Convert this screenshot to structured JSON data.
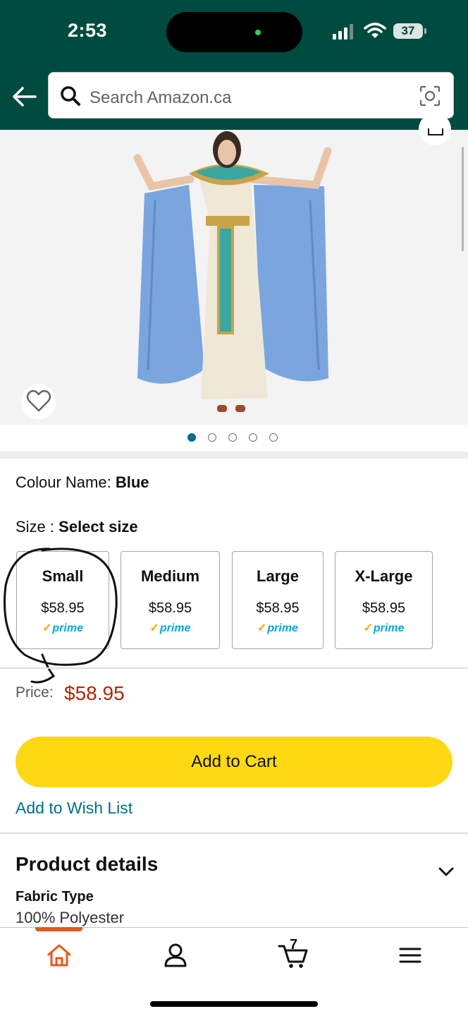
{
  "status_bar": {
    "time": "2:53",
    "battery": "37"
  },
  "search": {
    "placeholder": "Search Amazon.ca"
  },
  "product": {
    "image_count": 5,
    "active_image": 1,
    "colour_label": "Colour Name:",
    "colour_value": "Blue",
    "size_label": "Size :",
    "size_value": "Select size",
    "sizes": [
      {
        "name": "Small",
        "price": "$58.95",
        "badge": "prime"
      },
      {
        "name": "Medium",
        "price": "$58.95",
        "badge": "prime"
      },
      {
        "name": "Large",
        "price": "$58.95",
        "badge": "prime"
      },
      {
        "name": "X-Large",
        "price": "$58.95",
        "badge": "prime"
      }
    ],
    "price_label": "Price:",
    "price": "$58.95"
  },
  "actions": {
    "add_to_cart": "Add to Cart",
    "add_to_wish_list": "Add to Wish List"
  },
  "details": {
    "title": "Product details",
    "fabric_label": "Fabric Type",
    "fabric_value": "100% Polyester"
  },
  "bottom_nav": {
    "cart_count": "7",
    "items": [
      "home-icon",
      "account-icon",
      "cart-icon",
      "menu-icon"
    ]
  },
  "colors": {
    "header": "#004b3f",
    "cart_button": "#ffd814",
    "price": "#b12704",
    "link": "#007185",
    "nav_active": "#e8571c"
  }
}
